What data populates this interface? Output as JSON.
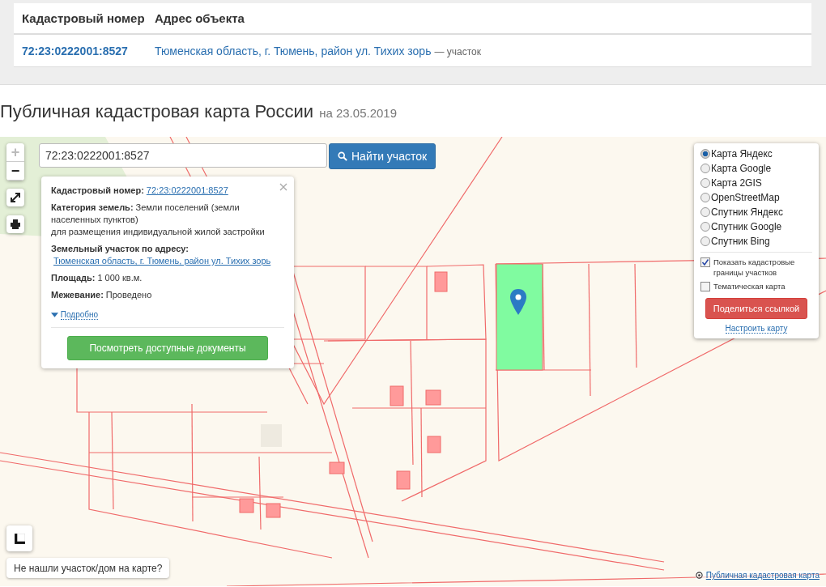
{
  "result_table": {
    "columns": [
      "Кадастровый номер",
      "Адрес объекта"
    ],
    "rows": [
      {
        "number": "72:23:0222001:8527",
        "address": "Тюменская область, г. Тюмень, район ул. Тихих зорь",
        "type": "— участок"
      }
    ]
  },
  "heading": {
    "title": "Публичная кадастровая карта России",
    "date": "на 23.05.2019"
  },
  "map": {
    "search": {
      "value": "72:23:0222001:8527",
      "button": "Найти участок"
    },
    "zoom_in": {
      "label": "+",
      "disabled": true
    },
    "zoom_out": {
      "label": "−",
      "disabled": false
    },
    "popup": {
      "fields": [
        {
          "kind": "link",
          "label": "Кадастровый номер:",
          "value": "72:23:0222001:8527"
        },
        {
          "kind": "text",
          "label": "Категория земель:",
          "value": "Земли поселений (земли населенных пунктов)",
          "extra": "для размещения индивидуальной жилой застройки"
        },
        {
          "kind": "link",
          "label": "Земельный участок по адресу:",
          "value": "Тюменская область, г. Тюмень, район ул. Тихих зорь"
        },
        {
          "kind": "text",
          "label": "Площадь:",
          "value": "1 000 кв.м."
        },
        {
          "kind": "text",
          "label": "Межевание:",
          "value": "Проведено"
        }
      ],
      "more": "Подробно",
      "button": "Посмотреть доступные документы"
    },
    "layers": [
      {
        "label": "Карта Яндекс",
        "selected": true
      },
      {
        "label": "Карта Google",
        "selected": false
      },
      {
        "label": "Карта 2GIS",
        "selected": false
      },
      {
        "label": "OpenStreetMap",
        "selected": false
      },
      {
        "label": "Спутник Яндекс",
        "selected": false
      },
      {
        "label": "Спутник Google",
        "selected": false
      },
      {
        "label": "Спутник Bing",
        "selected": false
      }
    ],
    "options": [
      {
        "label": "Показать кадастровые границы участков",
        "checked": true
      },
      {
        "label": "Тематическая карта",
        "checked": false
      }
    ],
    "share_button": "Поделиться ссылкой",
    "configure_link": "Настроить карту",
    "not_found_button": "Не нашли участок/дом на карте?",
    "attribution": "Публичная кадастровая карта"
  }
}
